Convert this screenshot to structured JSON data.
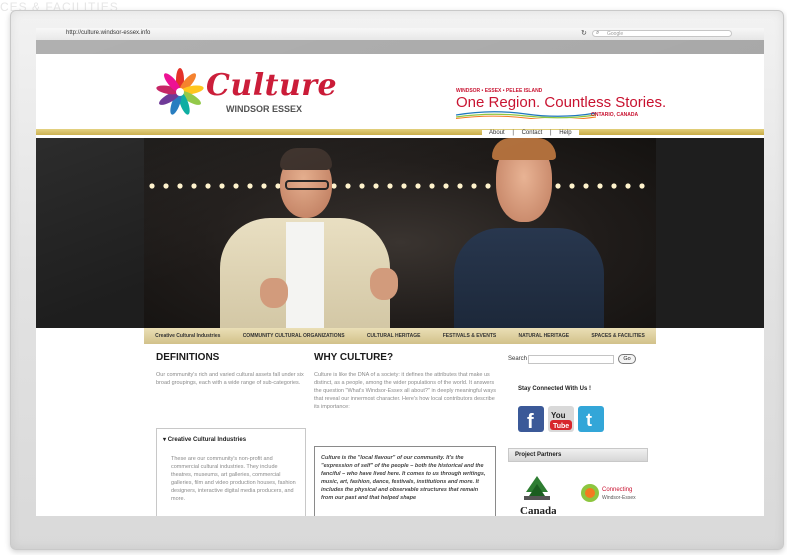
{
  "background_text": "CES & FACILITIES",
  "browser": {
    "url": "http://culture.windsor-essex.info",
    "reload_icon": "reload-icon",
    "search_placeholder": "Google",
    "search_icon": "search-icon"
  },
  "header": {
    "logo_text": "Culture",
    "logo_subtitle": "WINDSOR ESSEX",
    "region_small": "WINDSOR • ESSEX • PELEE ISLAND",
    "region_tagline": "One Region. Countless Stories.",
    "region_sub": "ONTARIO, CANADA"
  },
  "utility_links": [
    {
      "label": "About"
    },
    {
      "label": "Contact"
    },
    {
      "label": "Help"
    }
  ],
  "utility_separator": "|",
  "nav": [
    {
      "label": "Creative Cultural Industries"
    },
    {
      "label": "COMMUNITY CULTURAL ORGANIZATIONS"
    },
    {
      "label": "CULTURAL HERITAGE"
    },
    {
      "label": "FESTIVALS & EVENTS"
    },
    {
      "label": "NATURAL HERITAGE"
    },
    {
      "label": "SPACES & FACILITIES"
    }
  ],
  "definitions": {
    "title": "DEFINITIONS",
    "intro": "Our community's rich and varied cultural assets fall under six broad groupings, each with a wide range of sub-categories.",
    "box_title": "Creative Cultural Industries",
    "box_desc": "These are our community's non-profit and commercial cultural industries. They include theatres, museums, art galleries, commercial galleries, film and video production houses, fashion designers, interactive digital media producers, and more."
  },
  "why_culture": {
    "title": "WHY CULTURE?",
    "body": "Culture is like the DNA of a society: it defines the attributes that make us distinct, as a people, among the wider populations of the world. It answers the question \"What's Windsor-Essex all about?\" in deeply meaningful ways that reveal our innermost character. Here's how local contributors describe its importance:",
    "quote": "Culture is the \"local flavour\" of our community. It's the \"expression of self\" of the people – both the historical and the fanciful – who have lived here. It comes to us through writings, music, art, fashion, dance, festivals, institutions and more. It includes the physical and observable structures that remain from our past and that helped shape"
  },
  "sidebar": {
    "search_label": "Search",
    "go_label": "Go",
    "stay_connected": "Stay Connected With Us !",
    "social": [
      {
        "name": "facebook-icon",
        "glyph": "f"
      },
      {
        "name": "youtube-icon",
        "glyph": "You"
      },
      {
        "name": "twitter-icon",
        "glyph": "t"
      }
    ],
    "partners_title": "Project Partners",
    "partner1": "Canada",
    "partner2": "Connecting Windsor-Essex"
  },
  "colors": {
    "brand_red": "#c8102e",
    "nav_gold": "#d2c18a",
    "facebook": "#3b5998",
    "twitter": "#33a6d8"
  }
}
